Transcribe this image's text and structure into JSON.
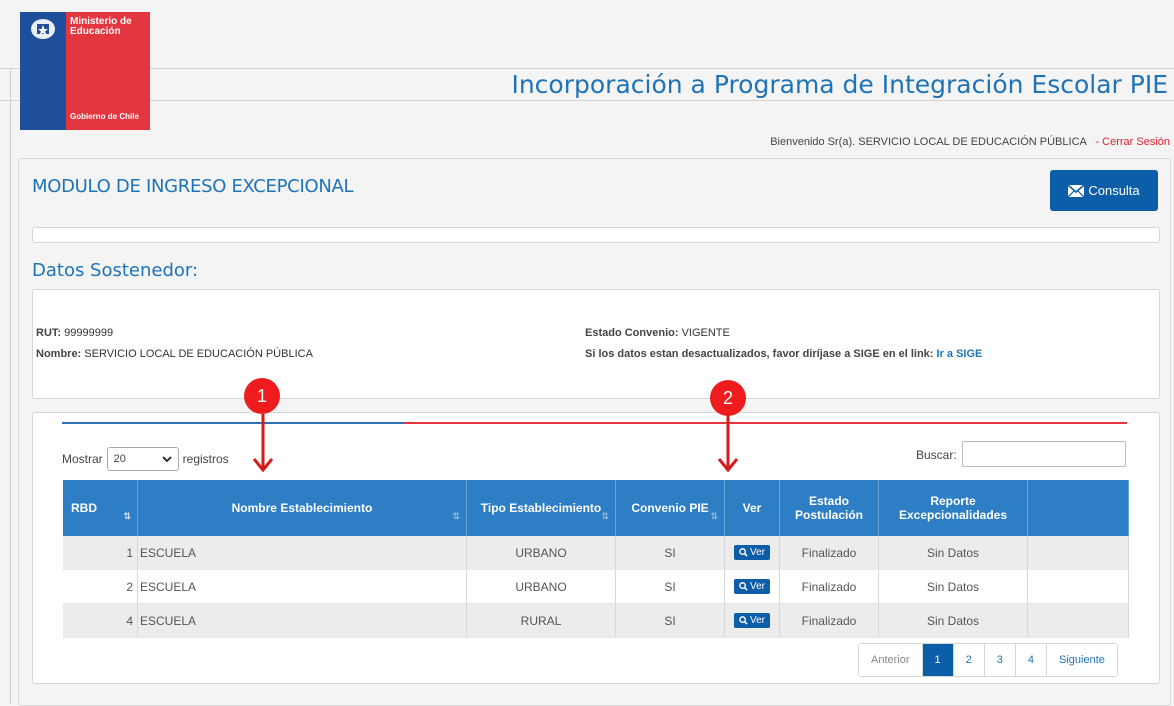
{
  "header": {
    "logo_line1": "Ministerio de",
    "logo_line2": "Educación",
    "logo_footer": "Gobierno de Chile",
    "app_title": "Incorporación a Programa de Integración Escolar PIE",
    "welcome": "Bienvenido Sr(a). SERVICIO LOCAL DE EDUCACIÓN PÚBLICA",
    "logout": "- Cerrar Sesión"
  },
  "module": {
    "title": "MODULO DE INGRESO EXCEPCIONAL",
    "consulta_label": "Consulta"
  },
  "sostenedor": {
    "section_title": "Datos Sostenedor:",
    "rut_label": "RUT:",
    "rut_value": "99999999",
    "nombre_label": "Nombre:",
    "nombre_value": "SERVICIO LOCAL DE EDUCACIÓN PÚBLICA",
    "estado_label": "Estado Convenio:",
    "estado_value": "VIGENTE",
    "sige_text": "Si los datos estan desactualizados, favor diríjase a SIGE en el link:",
    "sige_link": "Ir a SIGE"
  },
  "table_controls": {
    "mostrar": "Mostrar",
    "page_size": "20",
    "registros": "registros",
    "buscar": "Buscar:",
    "search_value": ""
  },
  "table": {
    "columns": [
      "RBD",
      "Nombre Establecimiento",
      "Tipo Establecimiento",
      "Convenio PIE",
      "Ver",
      "Estado Postulación",
      "Reporte Excepcionalidades",
      ""
    ],
    "ver_label": "Ver",
    "rows": [
      {
        "rbd": "1",
        "nombre": "ESCUELA",
        "tipo": "URBANO",
        "convenio": "SI",
        "estado": "Finalizado",
        "reporte": "Sin Datos"
      },
      {
        "rbd": "2",
        "nombre": "ESCUELA",
        "tipo": "URBANO",
        "convenio": "SI",
        "estado": "Finalizado",
        "reporte": "Sin Datos"
      },
      {
        "rbd": "4",
        "nombre": "ESCUELA",
        "tipo": "RURAL",
        "convenio": "SI",
        "estado": "Finalizado",
        "reporte": "Sin Datos"
      }
    ]
  },
  "pagination": {
    "anterior": "Anterior",
    "pages": [
      "1",
      "2",
      "3",
      "4"
    ],
    "siguiente": "Siguiente"
  },
  "annotations": {
    "marker1": "1",
    "marker2": "2"
  },
  "colors": {
    "brand_blue": "#1f73b7",
    "button_blue": "#0d5ea8",
    "header_blue": "#2d7ec4",
    "accent_red": "#e3363f",
    "marker_red": "#ee1c1c"
  }
}
